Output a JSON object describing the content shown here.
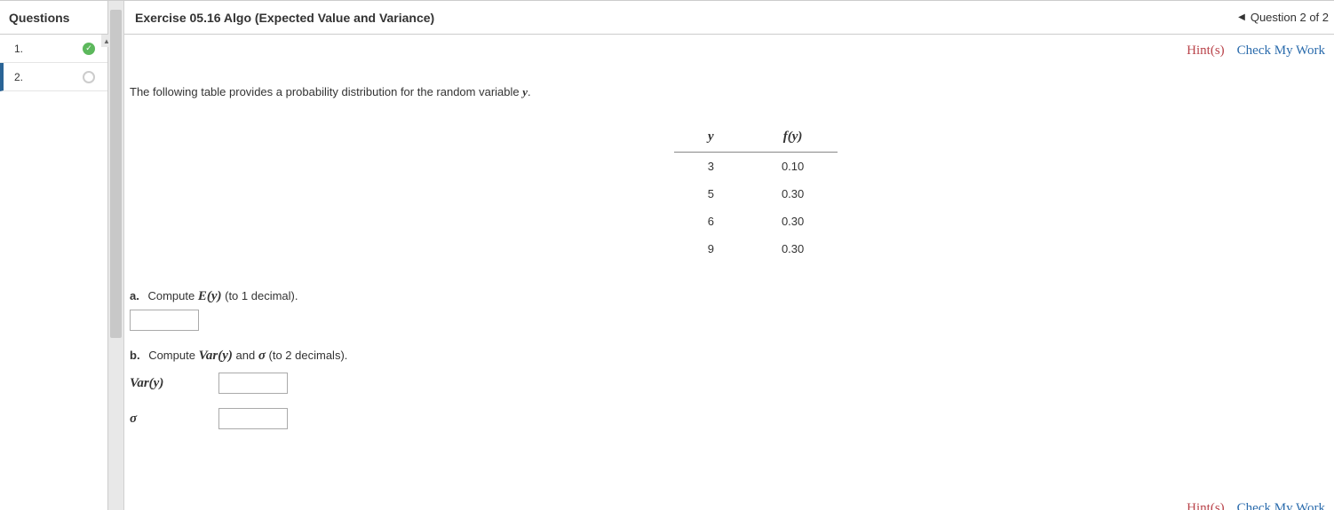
{
  "sidebar": {
    "header": "Questions",
    "items": [
      {
        "num": "1.",
        "status": "check"
      },
      {
        "num": "2.",
        "status": "empty"
      }
    ]
  },
  "header": {
    "title": "Exercise 05.16 Algo (Expected Value and Variance)",
    "nav": "Question 2 of 2"
  },
  "toolbar": {
    "hints": "Hint(s)",
    "check": "Check My Work"
  },
  "problem": {
    "intro_pre": "The following table provides a probability distribution for the random variable ",
    "intro_var": "y",
    "intro_post": ".",
    "table": {
      "col_y": "y",
      "col_fy": "f(y)",
      "rows": [
        {
          "y": "3",
          "fy": "0.10"
        },
        {
          "y": "5",
          "fy": "0.30"
        },
        {
          "y": "6",
          "fy": "0.30"
        },
        {
          "y": "9",
          "fy": "0.30"
        }
      ]
    },
    "part_a": {
      "label": "a.",
      "pre": "Compute ",
      "expr": "E(y)",
      "post": " (to 1 decimal)."
    },
    "part_b": {
      "label": "b.",
      "pre": "Compute ",
      "expr1": "Var(y)",
      "mid": " and ",
      "expr2": "σ",
      "post": " (to 2 decimals).",
      "row1_label": "Var(y)",
      "row2_label": "σ"
    }
  }
}
